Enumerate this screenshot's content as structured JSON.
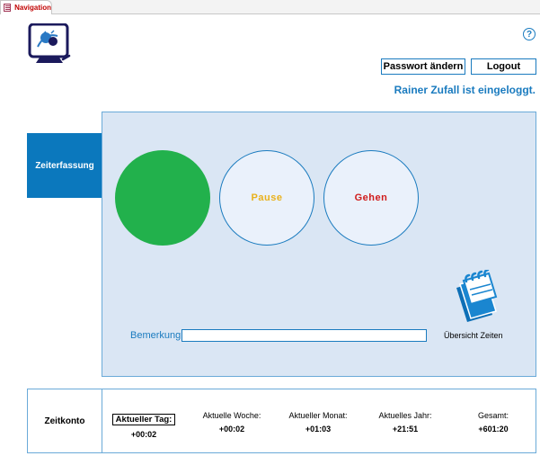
{
  "tab": {
    "label": "Navigation",
    "icon": "form-icon"
  },
  "header": {
    "password_button": "Passwort ändern",
    "logout_button": "Logout",
    "help_symbol": "?",
    "logged_in_text": "Rainer Zufall ist eingeloggt."
  },
  "nav": {
    "zeiterfassung": "Zeiterfassung",
    "zeitkonto": "Zeitkonto"
  },
  "actions": {
    "kommen_label": "",
    "pause_label": "Pause",
    "gehen_label": "Gehen",
    "overview_label": "Übersicht Zeiten",
    "overview_icon": "calendar-icon"
  },
  "remark": {
    "label": "Bemerkung:",
    "value": ""
  },
  "account": {
    "columns": [
      {
        "label": "Aktueller Tag:",
        "value": "+00:02"
      },
      {
        "label": "Aktuelle Woche:",
        "value": "+00:02"
      },
      {
        "label": "Aktueller Monat:",
        "value": "+01:03"
      },
      {
        "label": "Aktuelles Jahr:",
        "value": "+21:51"
      },
      {
        "label": "Gesamt:",
        "value": "+601:20"
      }
    ]
  },
  "colors": {
    "accent": "#1a7bbf",
    "nav_active": "#0b78bd",
    "panel": "#dae6f4",
    "kommen": "#22b14c",
    "pause": "#e9b11c",
    "gehen": "#d01c1c"
  }
}
